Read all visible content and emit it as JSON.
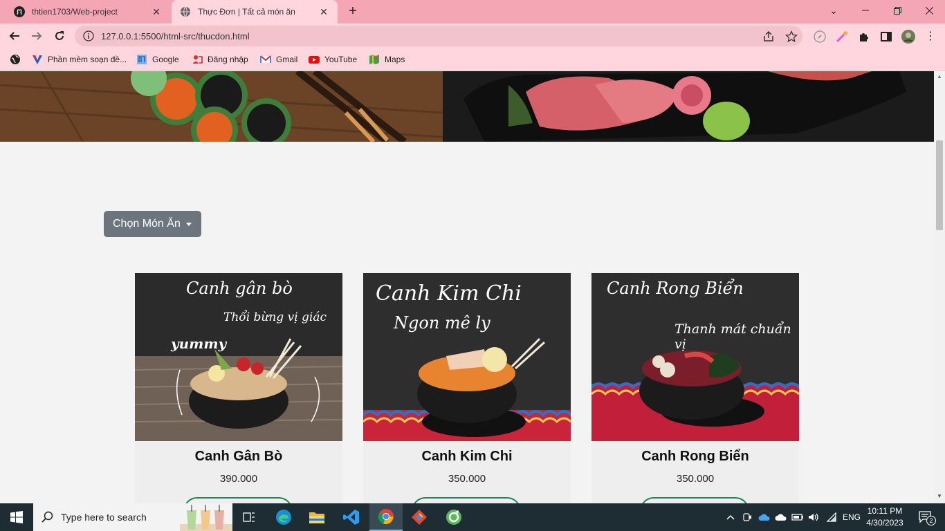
{
  "browser": {
    "tabs": [
      {
        "title": "thtien1703/Web-project",
        "icon": "github-icon"
      },
      {
        "title": "Thực Đơn | Tất cả món ăn",
        "icon": "globe-icon"
      }
    ],
    "url": "127.0.0.1:5500/html-src/thucdon.html",
    "bookmarks": [
      {
        "label": "Phần mềm soạn đề...",
        "icon": "v-logo-icon"
      },
      {
        "label": "Google",
        "icon": "google-icon"
      },
      {
        "label": "Đăng nhập",
        "icon": "login-site-icon"
      },
      {
        "label": "Gmail",
        "icon": "gmail-icon"
      },
      {
        "label": "YouTube",
        "icon": "youtube-icon"
      },
      {
        "label": "Maps",
        "icon": "maps-icon"
      }
    ]
  },
  "page": {
    "dropdown_label": "Chọn Món Ăn",
    "cards": [
      {
        "name": "Canh Gân Bò",
        "price": "390.000",
        "image_text": [
          "Canh gân bò",
          "Thổi bừng vị giác",
          "yummy"
        ]
      },
      {
        "name": "Canh Kim Chi",
        "price": "350.000",
        "image_text": [
          "Canh Kim Chi",
          "Ngon mê ly"
        ]
      },
      {
        "name": "Canh Rong Biển",
        "price": "350.000",
        "image_text": [
          "Canh Rong Biển",
          "Thanh mát chuẩn vị"
        ]
      }
    ]
  },
  "taskbar": {
    "search_placeholder": "Type here to search",
    "language": "ENG",
    "time": "10:11 PM",
    "date": "4/30/2023",
    "notification_count": "2"
  },
  "colors": {
    "tabbar": "#f4a6b5",
    "toolbar": "#ffd6de",
    "dropdown": "#6c757d",
    "order_border": "#198754",
    "taskbar": "#1e2c34"
  }
}
